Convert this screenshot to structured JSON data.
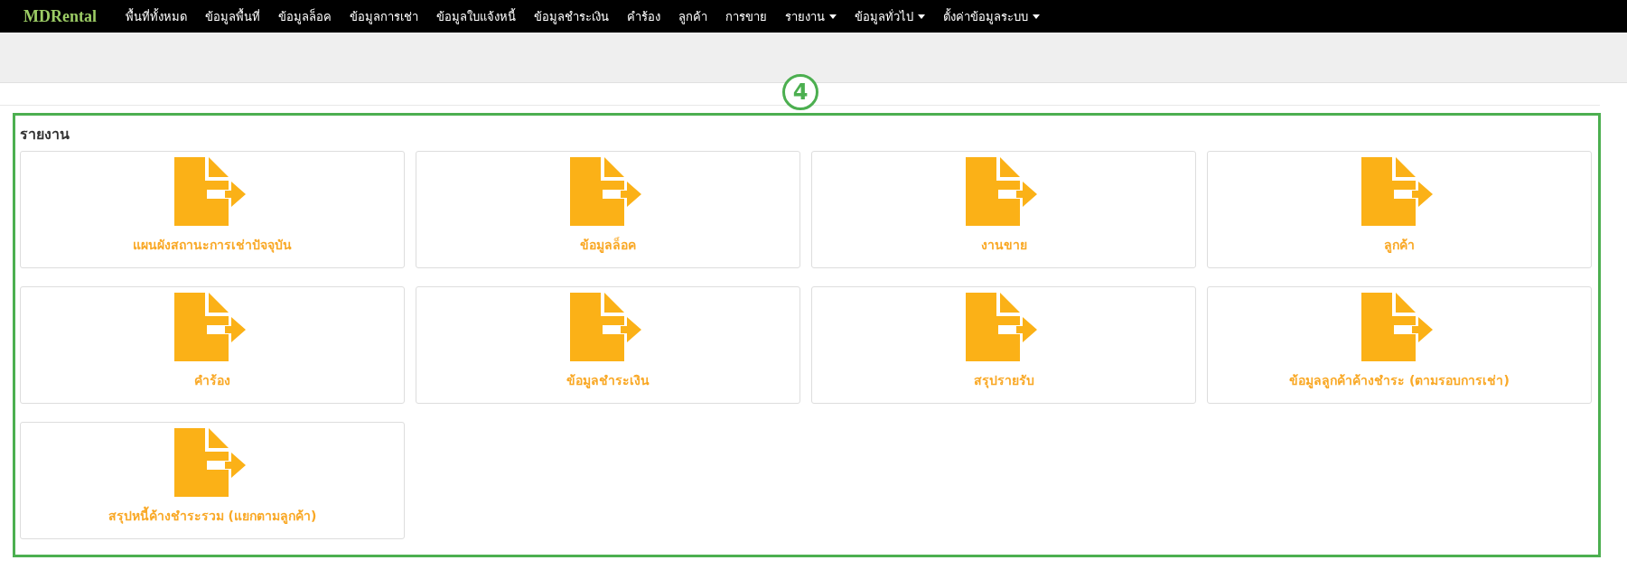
{
  "navbar": {
    "brand": "MDRental",
    "items": [
      {
        "label": "พื้นที่ทั้งหมด",
        "dropdown": false
      },
      {
        "label": "ข้อมูลพื้นที่",
        "dropdown": false
      },
      {
        "label": "ข้อมูลล็อค",
        "dropdown": false
      },
      {
        "label": "ข้อมูลการเช่า",
        "dropdown": false
      },
      {
        "label": "ข้อมูลใบแจ้งหนี้",
        "dropdown": false
      },
      {
        "label": "ข้อมูลชำระเงิน",
        "dropdown": false
      },
      {
        "label": "คำร้อง",
        "dropdown": false
      },
      {
        "label": "ลูกค้า",
        "dropdown": false
      },
      {
        "label": "การขาย",
        "dropdown": false
      },
      {
        "label": "รายงาน",
        "dropdown": true
      },
      {
        "label": "ข้อมูลทั่วไป",
        "dropdown": true
      },
      {
        "label": "ตั้งค่าข้อมูลระบบ",
        "dropdown": true
      }
    ]
  },
  "annotation": {
    "label": "4"
  },
  "section": {
    "title": "รายงาน",
    "reports": [
      {
        "label": "แผนผังสถานะการเช่าปัจจุบัน"
      },
      {
        "label": "ข้อมูลล็อค"
      },
      {
        "label": "งานขาย"
      },
      {
        "label": "ลูกค้า"
      },
      {
        "label": "คำร้อง"
      },
      {
        "label": "ข้อมูลชำระเงิน"
      },
      {
        "label": "สรุปรายรับ"
      },
      {
        "label": "ข้อมูลลูกค้าค้างชำระ (ตามรอบการเช่า)"
      },
      {
        "label": "สรุปหนี้ค้างชำระรวม (แยกตามลูกค้า)"
      }
    ]
  }
}
